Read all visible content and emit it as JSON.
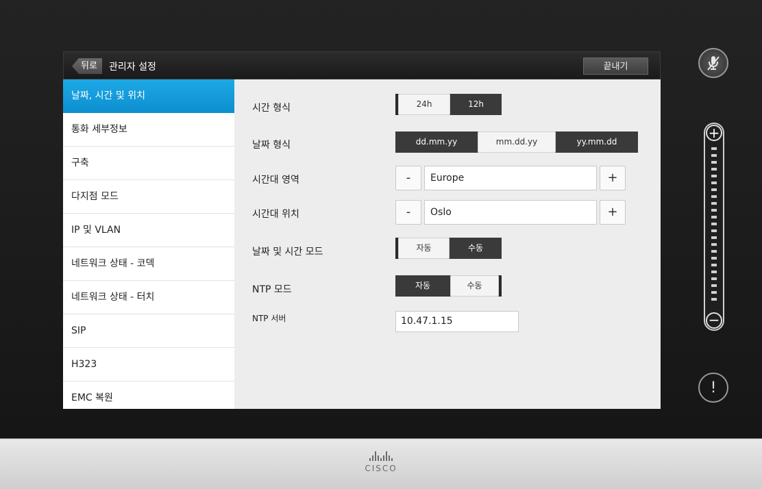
{
  "header": {
    "back_label": "뒤로",
    "title": "관리자 설정",
    "exit_label": "끝내기"
  },
  "sidebar": {
    "items": [
      {
        "label": "날짜, 시간 및 위치",
        "active": true
      },
      {
        "label": "통화 세부정보"
      },
      {
        "label": "구축"
      },
      {
        "label": "다지점 모드"
      },
      {
        "label": "IP 및 VLAN"
      },
      {
        "label": "네트워크 상태 - 코덱"
      },
      {
        "label": "네트워크 상태 - 터치"
      },
      {
        "label": "SIP"
      },
      {
        "label": "H323"
      },
      {
        "label": "EMC 복원"
      }
    ]
  },
  "settings": {
    "time_format": {
      "label": "시간 형식",
      "options": [
        "24h",
        "12h"
      ],
      "selected": "24h"
    },
    "date_format": {
      "label": "날짜 형식",
      "options": [
        "dd.mm.yy",
        "mm.dd.yy",
        "yy.mm.dd"
      ],
      "selected": "mm.dd.yy"
    },
    "timezone_region": {
      "label": "시간대 영역",
      "value": "Europe",
      "minus": "-",
      "plus": "+"
    },
    "timezone_location": {
      "label": "시간대 위치",
      "value": "Oslo",
      "minus": "-",
      "plus": "+"
    },
    "datetime_mode": {
      "label": "날짜 및 시간 모드",
      "options": [
        "자동",
        "수동"
      ],
      "selected": "자동"
    },
    "ntp_mode": {
      "label": "NTP 모드",
      "options": [
        "자동",
        "수동"
      ],
      "selected": "수동"
    },
    "ntp_server": {
      "label": "NTP 서버",
      "value": "10.47.1.15"
    }
  },
  "controls": {
    "volume_plus": "+",
    "volume_minus": "−",
    "alert_symbol": "!",
    "mic_icon": "mic-muted-icon"
  },
  "branding": {
    "logo_text": "CISCO"
  },
  "colors": {
    "accent": "#1ea8e6",
    "background": "#1c1c1c"
  }
}
